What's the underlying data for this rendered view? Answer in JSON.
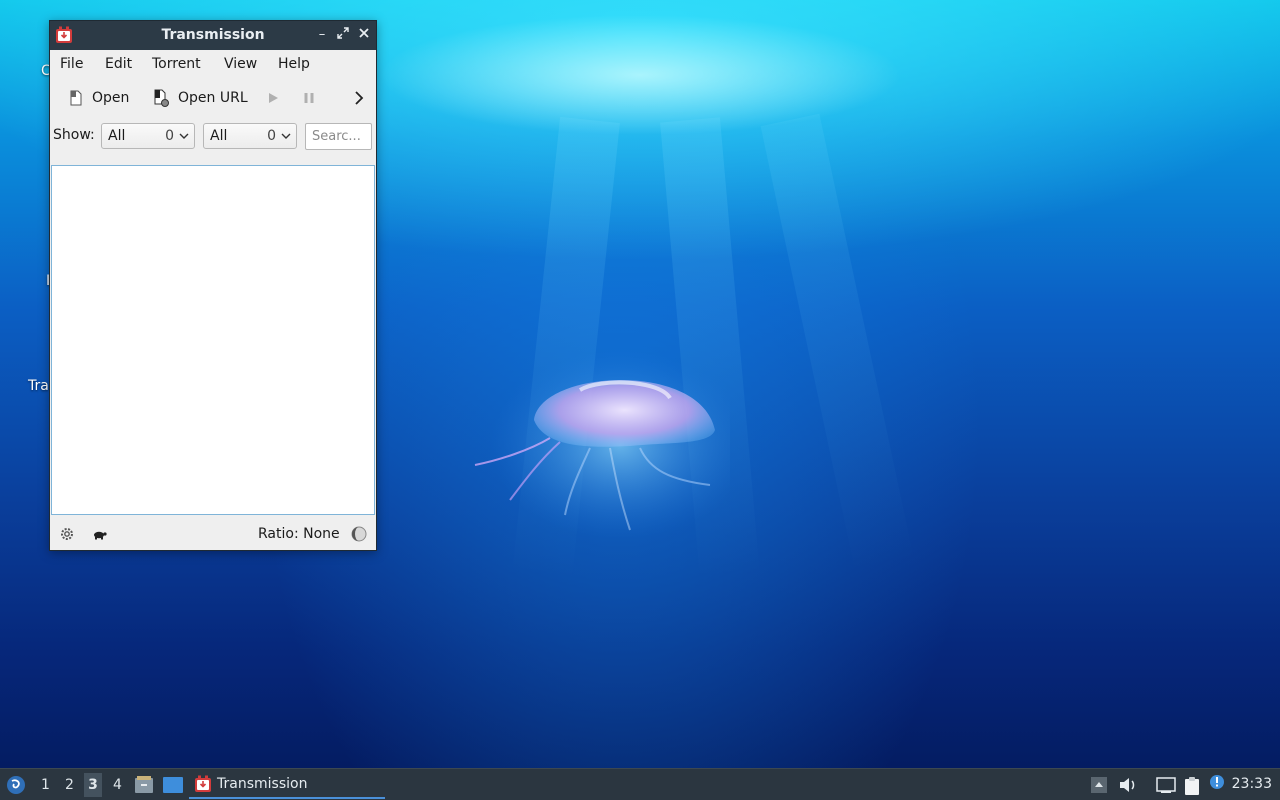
{
  "window": {
    "title": "Transmission",
    "menu": [
      "File",
      "Edit",
      "Torrent",
      "View",
      "Help"
    ],
    "toolbar": {
      "open_label": "Open",
      "open_url_label": "Open URL"
    },
    "filter": {
      "show_label": "Show:",
      "activity": {
        "value": "All",
        "count": "0"
      },
      "tracker": {
        "value": "All",
        "count": "0"
      },
      "search_placeholder": "Searc..."
    },
    "status": {
      "ratio_label": "Ratio: None"
    }
  },
  "desktop": {
    "icon_labels": [
      "C",
      "I",
      "Tra"
    ]
  },
  "taskbar": {
    "workspaces": [
      "1",
      "2",
      "3",
      "4"
    ],
    "active_workspace": "3",
    "task_label": "Transmission",
    "clock": "23:33"
  },
  "colors": {
    "titlebar": "#2c3a46",
    "taskbar": "#2b3640",
    "accent": "#4a90d9",
    "app_icon_red": "#d23c3c"
  }
}
